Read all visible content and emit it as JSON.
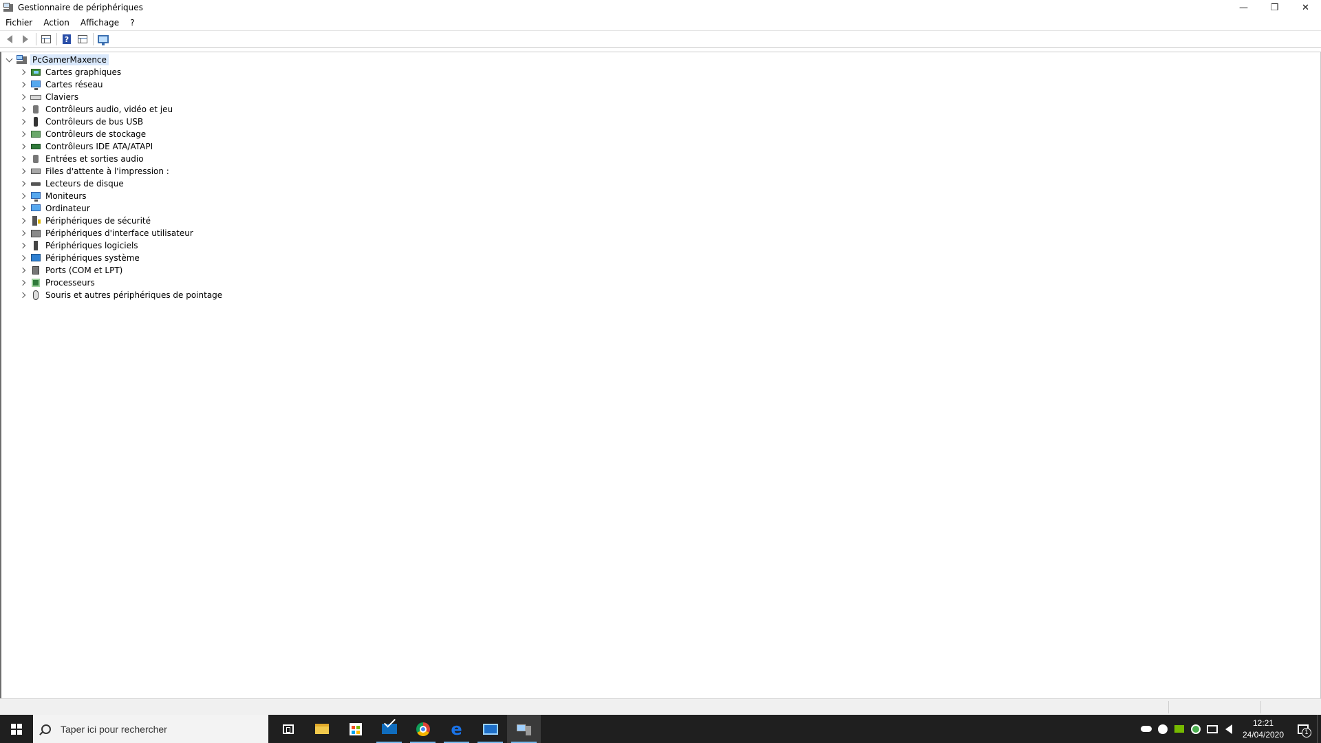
{
  "window": {
    "title": "Gestionnaire de périphériques",
    "controls": {
      "minimize": "—",
      "restore": "❐",
      "close": "✕"
    }
  },
  "menu": {
    "items": [
      "Fichier",
      "Action",
      "Affichage",
      "?"
    ]
  },
  "toolbar": {
    "icons": [
      "back-icon",
      "forward-icon",
      "properties-icon",
      "help-icon",
      "view-icon",
      "scan-hardware-icon"
    ]
  },
  "tree": {
    "root": {
      "label": "PcGamerMaxence",
      "icon": "computer-icon",
      "expanded": true
    },
    "categories": [
      {
        "label": "Cartes graphiques",
        "icon": "display-adapter-icon"
      },
      {
        "label": "Cartes réseau",
        "icon": "network-adapter-icon"
      },
      {
        "label": "Claviers",
        "icon": "keyboard-icon"
      },
      {
        "label": "Contrôleurs audio, vidéo et jeu",
        "icon": "audio-icon"
      },
      {
        "label": "Contrôleurs de bus USB",
        "icon": "usb-icon"
      },
      {
        "label": "Contrôleurs de stockage",
        "icon": "storage-controller-icon"
      },
      {
        "label": "Contrôleurs IDE ATA/ATAPI",
        "icon": "ide-icon"
      },
      {
        "label": "Entrées et sorties audio",
        "icon": "audio-io-icon"
      },
      {
        "label": "Files d'attente à l'impression :",
        "icon": "printer-icon"
      },
      {
        "label": "Lecteurs de disque",
        "icon": "disk-drive-icon"
      },
      {
        "label": "Moniteurs",
        "icon": "monitor-icon"
      },
      {
        "label": "Ordinateur",
        "icon": "computer-icon"
      },
      {
        "label": "Périphériques de sécurité",
        "icon": "security-device-icon"
      },
      {
        "label": "Périphériques d'interface utilisateur",
        "icon": "hid-icon"
      },
      {
        "label": "Périphériques logiciels",
        "icon": "software-device-icon"
      },
      {
        "label": "Périphériques système",
        "icon": "system-device-icon"
      },
      {
        "label": "Ports (COM et LPT)",
        "icon": "port-icon"
      },
      {
        "label": "Processeurs",
        "icon": "processor-icon"
      },
      {
        "label": "Souris et autres périphériques de pointage",
        "icon": "mouse-icon"
      }
    ]
  },
  "taskbar": {
    "search_placeholder": "Taper ici pour rechercher",
    "apps": [
      "task-view-icon",
      "file-explorer-icon",
      "store-icon",
      "mail-icon",
      "chrome-icon",
      "edge-icon",
      "control-panel-icon",
      "device-manager-icon"
    ],
    "tray_icons": [
      "onedrive-icon",
      "steam-icon",
      "nvidia-icon",
      "security-shield-icon",
      "network-icon",
      "volume-icon"
    ],
    "clock": {
      "time": "12:21",
      "date": "24/04/2020"
    },
    "notification_count": "1"
  },
  "colors": {
    "selection": "#d9e8fb",
    "taskbar": "#1f1f1f",
    "accent": "#76b9ed"
  }
}
